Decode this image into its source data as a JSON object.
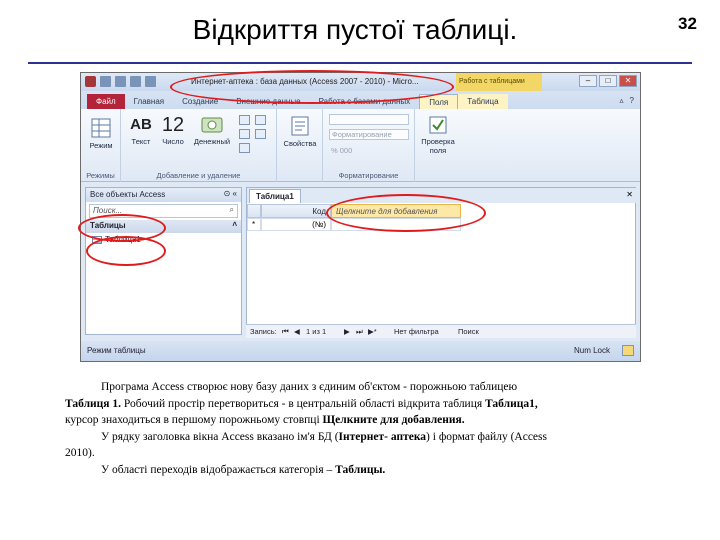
{
  "slide": {
    "title": "Відкриття пустої таблиці.",
    "number": "32"
  },
  "window": {
    "title": "Интернет-аптека : база данных (Access 2007 - 2010) - Micro...",
    "context_header": "Работа с таблицами",
    "buttons": [
      "–",
      "□",
      "✕"
    ]
  },
  "ribbon": {
    "tabs": [
      "Файл",
      "Главная",
      "Создание",
      "Внешние данные",
      "Работа с базами данных",
      "Поля",
      "Таблица"
    ],
    "active_tab": "Поля",
    "groups": [
      {
        "label": "Режимы",
        "commands": [
          "Режим"
        ]
      },
      {
        "label": "Добавление и удаление",
        "commands": [
          "Текст",
          "Число",
          "Денежный"
        ]
      },
      {
        "label": "",
        "commands": [
          "Свойства"
        ]
      },
      {
        "label": "Форматирование",
        "format_placeholder": "Форматирование",
        "symbols": "% 000"
      },
      {
        "label": "",
        "commands": [
          "Проверка поля"
        ]
      }
    ],
    "big_glyphs": {
      "text": "AB",
      "number": "12"
    }
  },
  "nav_pane": {
    "header": "Все объекты Access",
    "search_placeholder": "Поиск...",
    "category": "Таблицы",
    "items": [
      "Таблица1"
    ]
  },
  "document": {
    "tab": "Таблица1",
    "columns": [
      "Код",
      "Щелкните для добавления"
    ],
    "new_row_marker": "*",
    "new_row_value": "(№)"
  },
  "record_nav": {
    "label": "Запись:",
    "position": "1 из 1",
    "filter": "Нет фильтра",
    "search": "Поиск"
  },
  "status": {
    "left": "Режим таблицы",
    "right": "Num Lock"
  },
  "caption": {
    "p1": "Програма Access створює нову базу даних з єдиним об'єктом - порожньою таблицею",
    "p2_bold": "Таблиця 1.",
    "p2_rest": " Робочий простір перетвориться - в центральній області відкрита таблиця ",
    "p2_bold2": "Таблица1,",
    "p3": "курсор знаходиться в першому порожньому стовпці ",
    "p3_bold": "Щелкните для добавления.",
    "p4": "У рядку заголовка вікна Access вказано ім'я БД (",
    "p4_bold": "Інтернет- аптека",
    "p4_rest": ") і формат файлу (Access",
    "p5": "2010).",
    "p6": "У області переходів відображається категорія – ",
    "p6_bold": "Таблицы."
  },
  "colors": {
    "accent": "#2e3191",
    "annotation": "#e01b1b",
    "file_tab": "#b3233a",
    "context": "#f3d766"
  }
}
